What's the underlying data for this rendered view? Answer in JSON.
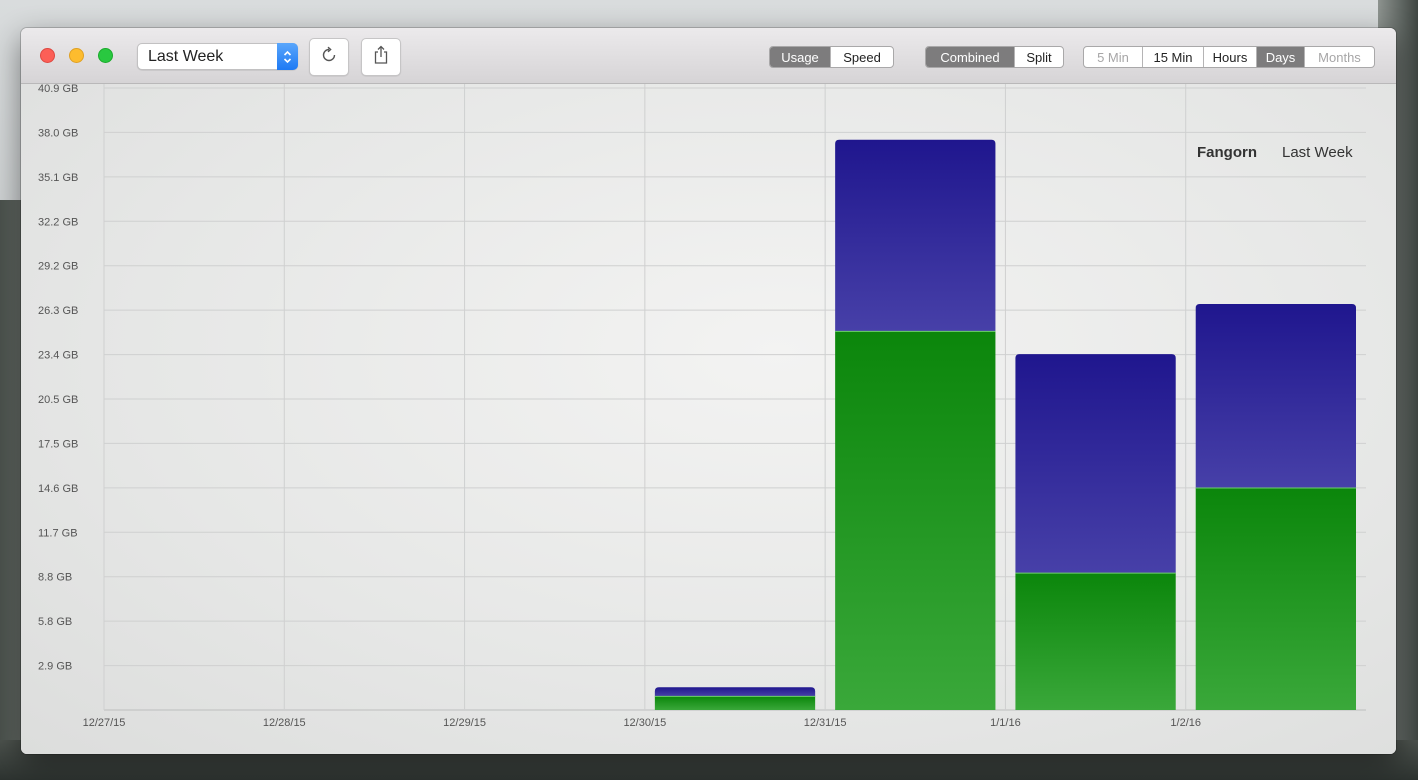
{
  "toolbar": {
    "period_select": "Last Week",
    "mode_options": [
      {
        "label": "Usage",
        "selected": true
      },
      {
        "label": "Speed",
        "selected": false
      }
    ],
    "view_options": [
      {
        "label": "Combined",
        "selected": true
      },
      {
        "label": "Split",
        "selected": false
      }
    ],
    "range_options": [
      {
        "label": "5 Min",
        "disabled": true
      },
      {
        "label": "15 Min",
        "disabled": false
      },
      {
        "label": "Hours",
        "disabled": false
      },
      {
        "label": "Days",
        "selected": true
      },
      {
        "label": "Months",
        "disabled": true
      }
    ],
    "refresh_icon": "refresh-icon",
    "share_icon": "share-icon"
  },
  "legend": {
    "host": "Fangorn",
    "period": "Last Week"
  },
  "colors": {
    "download": "#1f8a1f",
    "upload": "#2a229a"
  },
  "chart_data": {
    "type": "bar",
    "stacked": true,
    "categories": [
      "12/27/15",
      "12/28/15",
      "12/29/15",
      "12/30/15",
      "12/31/15",
      "1/1/16",
      "1/2/16"
    ],
    "y_tick_labels": [
      "2.9 GB",
      "5.8 GB",
      "8.8 GB",
      "11.7 GB",
      "14.6 GB",
      "17.5 GB",
      "20.5 GB",
      "23.4 GB",
      "26.3 GB",
      "29.2 GB",
      "32.2 GB",
      "35.1 GB",
      "38.0 GB",
      "40.9 GB"
    ],
    "ylim": [
      0,
      40.9
    ],
    "series": [
      {
        "values": [
          0,
          0,
          0,
          0.9,
          24.9,
          9.0,
          14.6
        ],
        "color": "#1f8a1f"
      },
      {
        "values": [
          0,
          0,
          0,
          0.6,
          12.6,
          14.4,
          12.1
        ],
        "color": "#2a229a"
      }
    ],
    "grid": true
  }
}
